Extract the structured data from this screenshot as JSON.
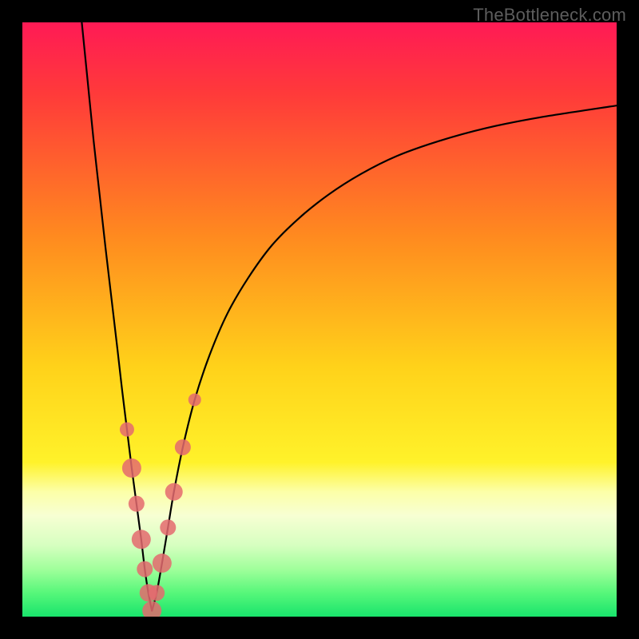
{
  "watermark": "TheBottleneck.com",
  "chart_data": {
    "type": "line",
    "title": "",
    "xlabel": "",
    "ylabel": "",
    "xlim": [
      0,
      100
    ],
    "ylim": [
      0,
      100
    ],
    "background_gradient_stops": [
      {
        "pct": 0,
        "color": "#ff1a55"
      },
      {
        "pct": 12,
        "color": "#ff3a3a"
      },
      {
        "pct": 36,
        "color": "#ff8a1f"
      },
      {
        "pct": 58,
        "color": "#ffd21a"
      },
      {
        "pct": 74,
        "color": "#fff22a"
      },
      {
        "pct": 79,
        "color": "#fcffa8"
      },
      {
        "pct": 83,
        "color": "#f7ffd3"
      },
      {
        "pct": 88,
        "color": "#d6ffc0"
      },
      {
        "pct": 92,
        "color": "#a0ff9b"
      },
      {
        "pct": 96,
        "color": "#57f77a"
      },
      {
        "pct": 100,
        "color": "#19e46c"
      }
    ],
    "series": [
      {
        "name": "left_branch",
        "x": [
          10.0,
          11.0,
          12.0,
          13.0,
          14.0,
          15.0,
          16.0,
          16.8,
          17.6,
          18.4,
          19.2,
          20.0,
          20.6,
          21.2,
          21.8
        ],
        "y": [
          100.0,
          90.0,
          80.0,
          71.0,
          62.0,
          53.5,
          45.0,
          38.0,
          31.5,
          25.0,
          19.0,
          13.0,
          8.0,
          4.0,
          1.0
        ]
      },
      {
        "name": "right_branch",
        "x": [
          21.8,
          22.6,
          23.5,
          24.5,
          25.5,
          27.0,
          29.0,
          31.5,
          34.5,
          38.0,
          42.0,
          46.5,
          51.5,
          57.0,
          63.0,
          70.0,
          78.0,
          87.0,
          100.0
        ],
        "y": [
          1.0,
          4.0,
          9.0,
          15.0,
          21.0,
          28.5,
          36.5,
          44.0,
          51.0,
          57.0,
          62.5,
          67.0,
          71.0,
          74.5,
          77.5,
          80.0,
          82.2,
          84.0,
          86.0
        ]
      }
    ],
    "scatter": {
      "name": "highlighted_points",
      "color": "#e46a6f",
      "points": [
        {
          "x": 17.6,
          "y": 31.5,
          "r": 9
        },
        {
          "x": 18.4,
          "y": 25.0,
          "r": 12
        },
        {
          "x": 19.2,
          "y": 19.0,
          "r": 10
        },
        {
          "x": 20.0,
          "y": 13.0,
          "r": 12
        },
        {
          "x": 20.6,
          "y": 8.0,
          "r": 10
        },
        {
          "x": 21.2,
          "y": 4.0,
          "r": 11
        },
        {
          "x": 21.8,
          "y": 1.0,
          "r": 12
        },
        {
          "x": 22.6,
          "y": 4.0,
          "r": 10
        },
        {
          "x": 23.5,
          "y": 9.0,
          "r": 12
        },
        {
          "x": 24.5,
          "y": 15.0,
          "r": 10
        },
        {
          "x": 25.5,
          "y": 21.0,
          "r": 11
        },
        {
          "x": 27.0,
          "y": 28.5,
          "r": 10
        },
        {
          "x": 29.0,
          "y": 36.5,
          "r": 8
        }
      ]
    }
  }
}
